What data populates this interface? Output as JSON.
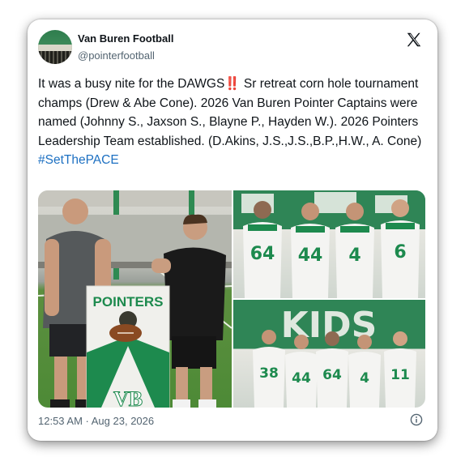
{
  "tweet": {
    "display_name": "Van Buren Football",
    "handle": "@pointerfootball",
    "text_part1": "It was a busy nite for the DAWGS",
    "text_emoji": "‼️",
    "text_part2": " Sr retreat corn hole tournament champs (Drew & Abe Cone). 2026 Van Buren Pointer Captains were named (Johnny S., Jaxson S., Blayne P., Hayden W.). 2026 Pointers Leadership Team established. (D.Akins, J.S.,J.S.,B.P.,H.W., A. Cone)",
    "hashtag": "#SetThePACE",
    "timestamp": "12:53 AM · Aug 23, 2026"
  },
  "photos": {
    "cornhole_board_text": "POINTERS",
    "board_logo": "VB",
    "top_jerseys": [
      "64",
      "44",
      "4",
      "6"
    ],
    "bottom_jerseys": [
      "38",
      "44",
      "64",
      "4",
      "11"
    ],
    "banner_text": "KIDS"
  },
  "icons": {
    "x_logo": "x-logo-icon",
    "info": "info-icon"
  },
  "colors": {
    "hashtag": "#1d70c2",
    "text": "#0f1419",
    "secondary": "#536471",
    "team_green": "#1d8a4e"
  }
}
